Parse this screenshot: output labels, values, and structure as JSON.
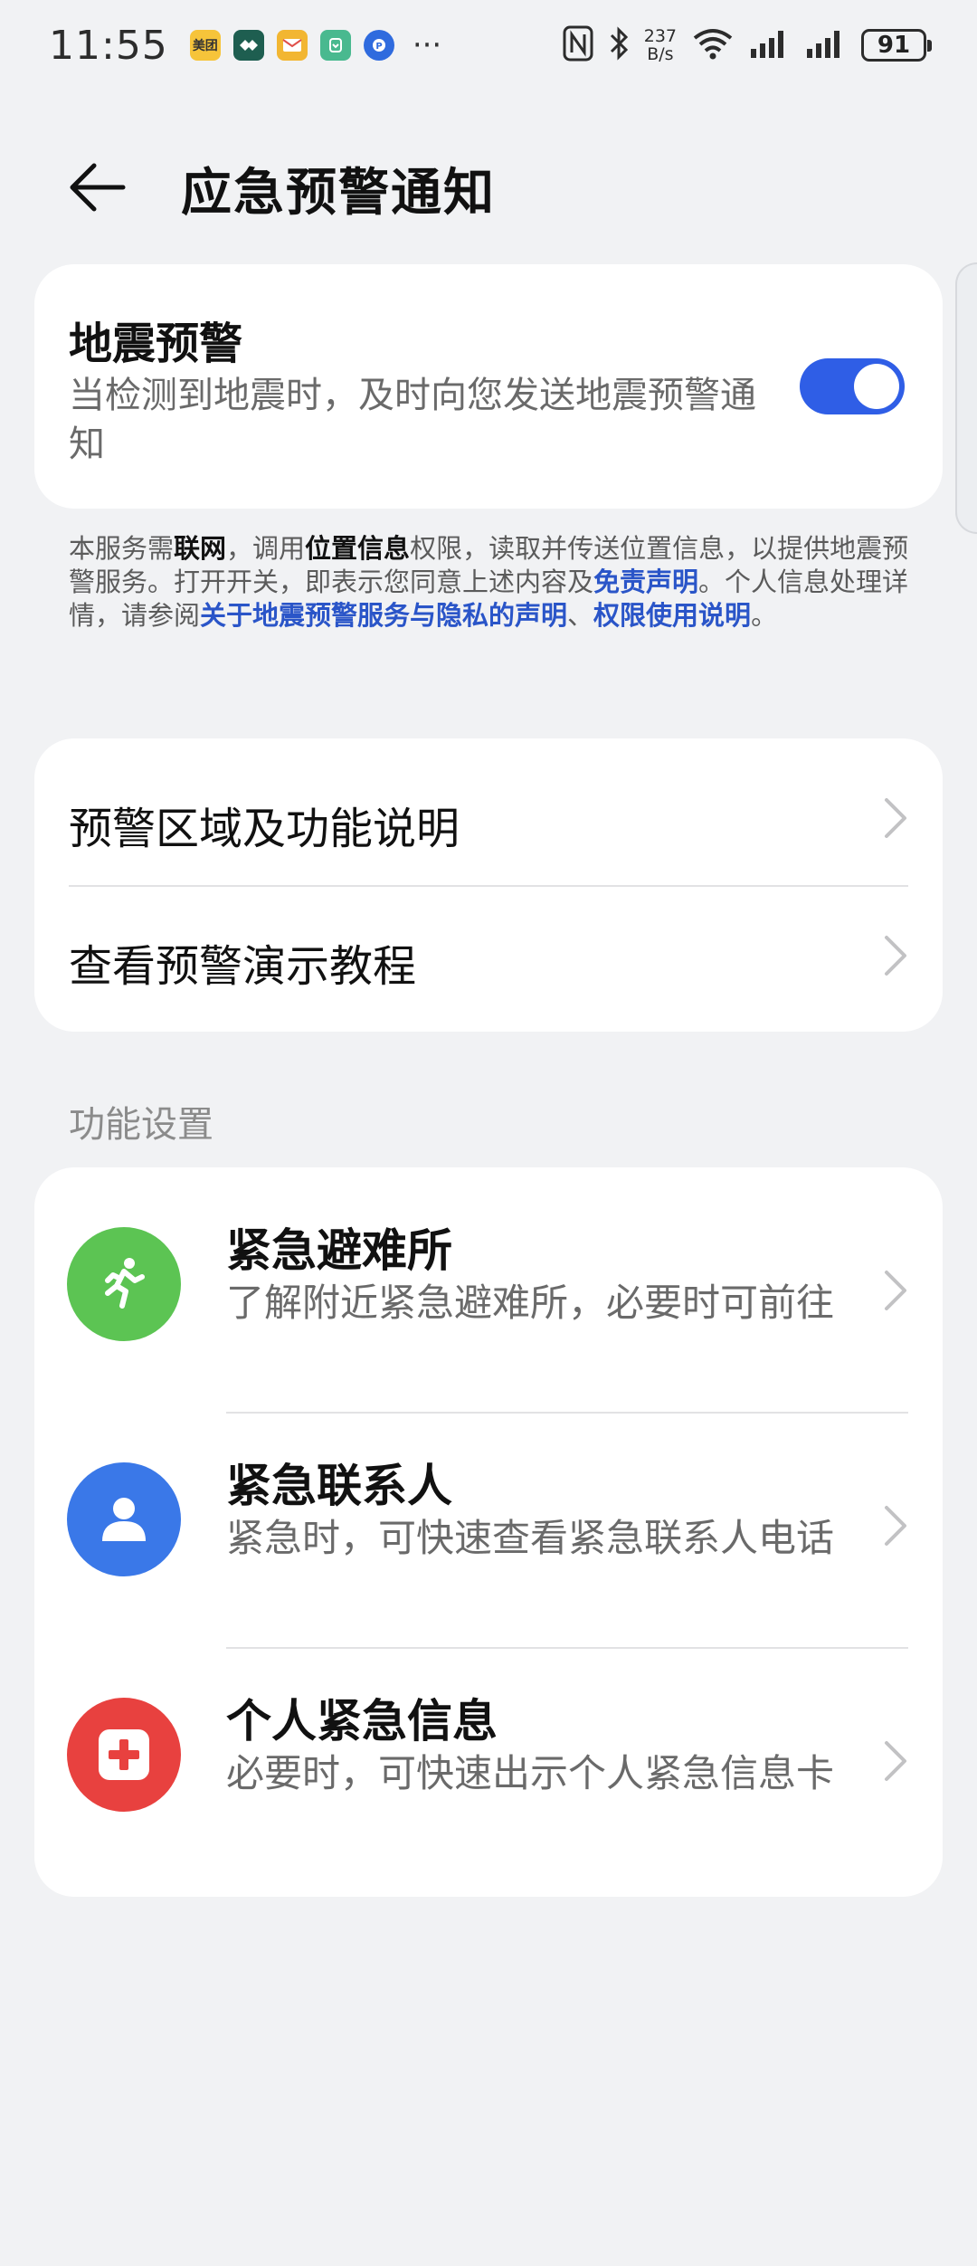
{
  "status_bar": {
    "time": "11:55",
    "app_icons": [
      {
        "name": "meituan-icon",
        "text": "美团",
        "color": "#f6c43a",
        "text_color": "#333"
      },
      {
        "name": "app-icon-green",
        "text": "",
        "color": "#1e5e50"
      },
      {
        "name": "mail-icon",
        "text": "",
        "color": "#f2b632"
      },
      {
        "name": "xiaomi-home-icon",
        "text": "",
        "color": "#49b98f"
      },
      {
        "name": "alipay-icon",
        "text": "",
        "color": "#2f6bde"
      }
    ],
    "more": "···",
    "net_speed_value": "237",
    "net_speed_unit": "B/s",
    "battery": "91"
  },
  "header": {
    "title": "应急预警通知"
  },
  "quake_card": {
    "title": "地震预警",
    "description": "当检测到地震时，及时向您发送地震预警通知",
    "toggle_on": true
  },
  "notice": {
    "t1": "本服务需",
    "b1": "联网",
    "t2": "，调用",
    "b2": "位置信息",
    "t3": "权限，读取并传送位置信息，以提供地震预警服务。打开开关，即表示您同意上述内容及",
    "l1": "免责声明",
    "t4": "。个人信息处理详情，请参阅",
    "l2": "关于地震预警服务与隐私的声明",
    "t5": "、",
    "l3": "权限使用说明",
    "t6": "。"
  },
  "links_card": {
    "items": [
      {
        "label": "预警区域及功能说明"
      },
      {
        "label": "查看预警演示教程"
      }
    ]
  },
  "section": {
    "title": "功能设置"
  },
  "settings": {
    "items": [
      {
        "title": "紧急避难所",
        "description": "了解附近紧急避难所，必要时可前往",
        "icon_color": "#5cc453"
      },
      {
        "title": "紧急联系人",
        "description": "紧急时，可快速查看紧急联系人电话",
        "icon_color": "#3a78e8"
      },
      {
        "title": "个人紧急信息",
        "description": "必要时，可快速出示个人紧急信息卡",
        "icon_color": "#e8413f"
      }
    ]
  }
}
